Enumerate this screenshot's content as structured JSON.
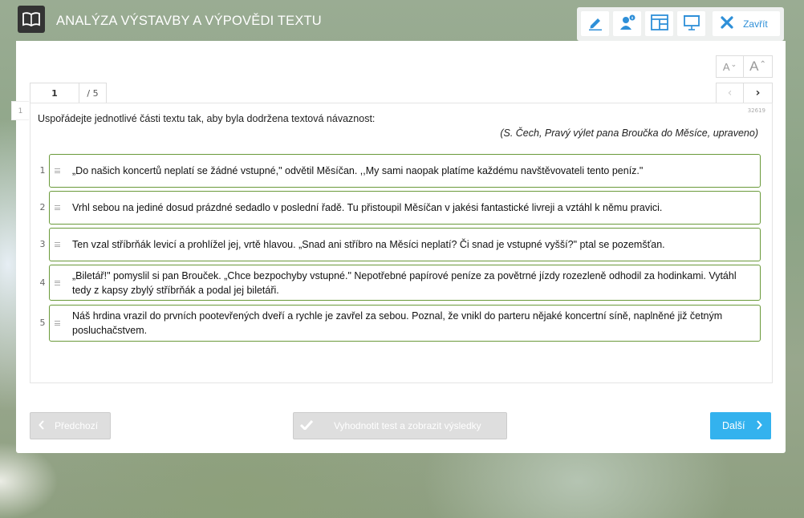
{
  "header": {
    "title": "ANALÝZA VÝSTAVBY A VÝPOVĚDI TEXTU",
    "close_label": "Zavřít"
  },
  "font_controls": {
    "decrease": "A",
    "increase": "A"
  },
  "pager": {
    "current": "1",
    "total": "/ 5"
  },
  "question": {
    "number": "1",
    "id": "32619",
    "instruction": "Uspořádejte jednotlivé části textu tak, aby byla dodržena textová návaznost:",
    "source": "(S. Čech, Pravý výlet pana Broučka do Měsíce, upraveno)",
    "items": [
      {
        "num": "1",
        "text": "„Do našich koncertů neplatí se žádné vstupné,\" odvětil Měsíčan. ,,My sami naopak platíme každému navštěvovateli tento peníz.\""
      },
      {
        "num": "2",
        "text": "Vrhl sebou na jediné dosud prázdné sedadlo v poslední řadě. Tu přistoupil Měsíčan v jakési fantastické livreji a vztáhl k němu pravici."
      },
      {
        "num": "3",
        "text": "Ten vzal stříbrňák levicí a prohlížel jej, vrtě hlavou. „Snad ani stříbro na Měsíci neplatí? Či snad je vstupné vyšší?\" ptal se pozemšťan."
      },
      {
        "num": "4",
        "text": "„Biletář!\" pomyslil si pan Brouček. „Chce bezpochyby vstupné.\" Nepotřebné papírové peníze za povětrné jízdy rozezleně odhodil za hodinkami. Vytáhl tedy z kapsy zbylý stříbrňák a podal jej biletáři."
      },
      {
        "num": "5",
        "text": "Náš hrdina vrazil do prvních pootevřených dveří a rychle je zavřel za sebou. Poznal, že vnikl do parteru nějaké koncertní síně, naplněné již četným posluchačstvem."
      }
    ]
  },
  "footer": {
    "prev_label": "Předchozí",
    "evaluate_label": "Vyhodnotit test a zobrazit výsledky",
    "next_label": "Další"
  },
  "colors": {
    "accent": "#33b2ee",
    "close_text": "#2e8fd8",
    "item_border": "#6a9a3a",
    "disabled_button": "#dedede"
  },
  "icons": {
    "logo": "book-icon",
    "toolbar": [
      "pencil-icon",
      "user-info-icon",
      "layout-icon",
      "presentation-icon",
      "close-icon"
    ]
  }
}
